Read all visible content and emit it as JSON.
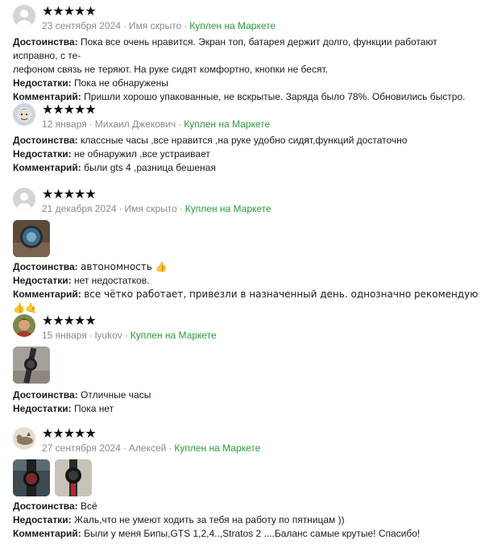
{
  "colors": {
    "stars": "#111111",
    "meta": "#8a8a8a",
    "bought": "#2a9a3b",
    "text": "#1a1a1a"
  },
  "reviews": [
    {
      "stars": "★★★★★",
      "date": "23 сентября 2024",
      "author": "Имя скрыто",
      "bought": "Куплен на Маркете",
      "advantages_label": "Достоинства:",
      "advantages": "Пока все очень нравится. Экран топ, батарея держит долго, функции работают исправно, с те-",
      "advantages_cont": "лефоном связь не теряют. На руке сидят комфортно, кнопки не бесят.",
      "disadvantages_label": "Недостатки:",
      "disadvantages": "Пока не обнаружены",
      "comment_label": "Комментарий:",
      "comment": "Пришли хорошо упакованные, не вскрытые. Заряда было 78%. Обновились быстро."
    },
    {
      "stars": "★★★★★",
      "date": "12 января",
      "author": "Михаил Джекович",
      "bought": "Куплен на Маркете",
      "advantages_label": "Достоинства:",
      "advantages": "классные часы ,все нравится ,на руке удобно сидят,функций достаточно",
      "disadvantages_label": "Недостатки:",
      "disadvantages": "не обнаружил ,все устраивает",
      "comment_label": "Комментарий:",
      "comment": "были gts 4 ,разница бешеная"
    },
    {
      "stars": "★★★★★",
      "date": "21 декабря 2024",
      "author": "Имя скрыто",
      "bought": "Куплен на Маркете",
      "advantages_label": "Достоинства:",
      "advantages": "автономность 👍",
      "disadvantages_label": "Недостатки:",
      "disadvantages": "нет недостатков.",
      "comment_label": "Комментарий:",
      "comment": "все чётко работает, привезли в назначенный день. однозначно рекомендую👍🤙"
    },
    {
      "stars": "★★★★★",
      "date": "15 января",
      "author": "lyukov",
      "bought": "Куплен на Маркете",
      "advantages_label": "Достоинства:",
      "advantages": "Отличные часы",
      "disadvantages_label": "Недостатки:",
      "disadvantages": "Пока нет"
    },
    {
      "stars": "★★★★★",
      "date": "27 сентября 2024",
      "author": "Алексей",
      "bought": "Куплен на Маркете",
      "advantages_label": "Достоинства:",
      "advantages": "Всё",
      "disadvantages_label": "Недостатки:",
      "disadvantages": "Жаль,что не умеют ходить за тебя на работу по пятницам ))",
      "comment_label": "Комментарий:",
      "comment": "Были у меня Бипы,GTS 1,2,4..,Stratos 2 ....Баланс самые крутые! Спасибо!"
    }
  ]
}
